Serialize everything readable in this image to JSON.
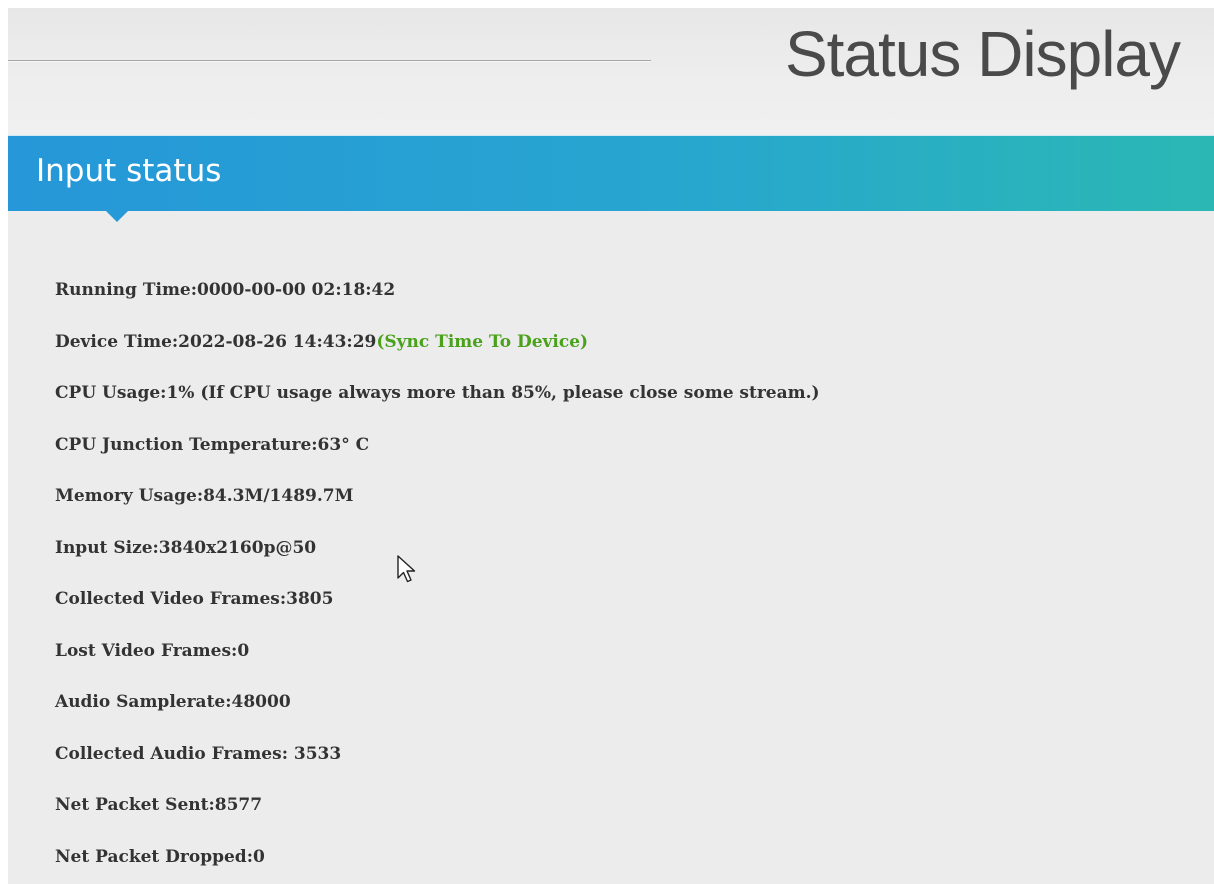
{
  "header": {
    "title": "Status Display"
  },
  "section": {
    "title": "Input status"
  },
  "status": {
    "running_time": "Running Time:0000-00-00 02:18:42",
    "device_time": "Device Time:2022-08-26 14:43:29",
    "sync_link": "(Sync Time To Device)",
    "cpu_usage": "CPU Usage:1% (If CPU usage always more than 85%, please close some stream.)",
    "cpu_temp": "CPU Junction Temperature:63° C",
    "memory_usage": "Memory Usage:84.3M/1489.7M",
    "input_size": "Input Size:3840x2160p@50",
    "collected_video_frames": "Collected Video Frames:3805",
    "lost_video_frames": "Lost Video Frames:0",
    "audio_samplerate": "Audio Samplerate:48000",
    "collected_audio_frames": "Collected Audio Frames: 3533",
    "net_packet_sent": "Net Packet Sent:8577",
    "net_packet_dropped": "Net Packet Dropped:0"
  },
  "colors": {
    "section_bar_start": "#2697d9",
    "section_bar_end": "#2bb8b4",
    "sync_link": "#4aa11c",
    "text": "#333333"
  },
  "icons": {
    "cursor": "mouse-pointer-icon"
  }
}
